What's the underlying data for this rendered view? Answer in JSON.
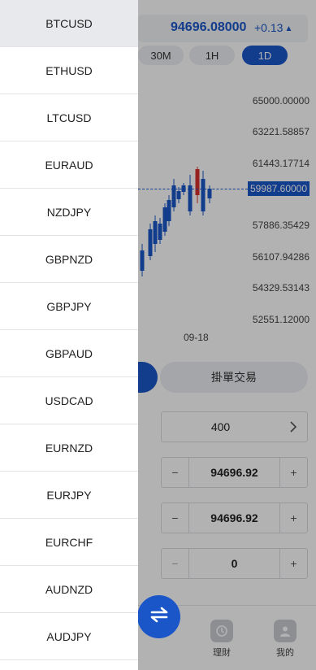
{
  "header": {
    "price": "94696.08000",
    "change": "+0.13",
    "timeframes": [
      "30M",
      "1H",
      "1D"
    ],
    "active_timeframe": "1D"
  },
  "chart_data": {
    "type": "candlestick",
    "y_tick_labels": [
      "65000.00000",
      "63221.58857",
      "61443.17714",
      "59987.60000",
      "57886.35429",
      "56107.94286",
      "54329.53143",
      "52551.12000"
    ],
    "current_price": "59987.60000",
    "x_tick_labels": [
      "09-18"
    ],
    "up_color": "#1b56c9",
    "down_color": "#d9302c"
  },
  "trade": {
    "pending_label": "掛單交易",
    "lot_select": "400",
    "stop_loss": "94696.92",
    "take_profit": "94696.92",
    "quantity": "0",
    "minus": "−",
    "plus": "+"
  },
  "nav": {
    "items": [
      {
        "label": "理財",
        "icon": "clock-icon"
      },
      {
        "label": "我的",
        "icon": "user-icon"
      }
    ]
  },
  "drawer": {
    "selected": "BTCUSD",
    "symbols": [
      "BTCUSD",
      "ETHUSD",
      "LTCUSD",
      "EURAUD",
      "NZDJPY",
      "GBPNZD",
      "GBPJPY",
      "GBPAUD",
      "USDCAD",
      "EURNZD",
      "EURJPY",
      "EURCHF",
      "AUDNZD",
      "AUDJPY"
    ]
  },
  "colors": {
    "accent": "#1b56c9",
    "down": "#d9302c",
    "overlay": "rgba(0,0,0,0.30)"
  }
}
